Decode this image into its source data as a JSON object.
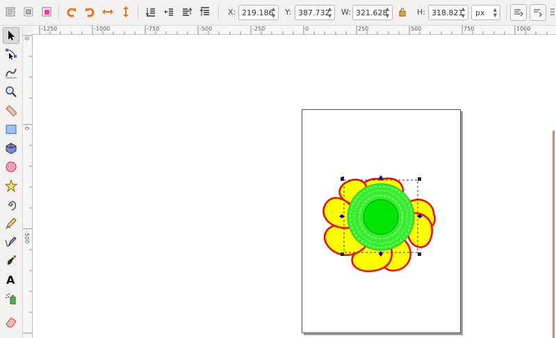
{
  "toolbar": {
    "x": {
      "label": "X:",
      "value": "219.186"
    },
    "y": {
      "label": "Y:",
      "value": "387.732"
    },
    "w": {
      "label": "W:",
      "value": "321.628"
    },
    "h": {
      "label": "H:",
      "value": "318.821"
    },
    "unit": "px",
    "buttons": [
      "select-all-icon",
      "select-all-layers-icon",
      "deselect-icon",
      "rotate-ccw-icon",
      "rotate-cw-icon",
      "flip-horizontal-icon",
      "flip-vertical-icon",
      "lower-bottom-icon",
      "lower-icon",
      "raise-icon",
      "raise-top-icon"
    ]
  },
  "ruler": {
    "h_labels": [
      "-1250",
      "-1000",
      "-750",
      "-500",
      "-250",
      "0",
      "250",
      "500",
      "750",
      "1000"
    ],
    "v_labels": [
      "0",
      "0",
      "-500",
      "-1000",
      "-1500"
    ]
  },
  "tools": [
    "selector-tool",
    "node-tool",
    "tweak-tool",
    "zoom-tool",
    "measure-tool",
    "rectangle-tool",
    "3d-box-tool",
    "ellipse-tool",
    "star-tool",
    "spiral-tool",
    "pencil-tool",
    "pen-tool",
    "calligraphy-tool",
    "text-tool",
    "spray-tool",
    "eraser-tool"
  ],
  "colors": {
    "petal_fill": "#ffff00",
    "petal_stroke": "#ff0000",
    "ring_fill": "#33ee33",
    "center_fill": "#00e600",
    "selection_handle": "#0000cc",
    "scroll_indicator": "#e9805c"
  }
}
